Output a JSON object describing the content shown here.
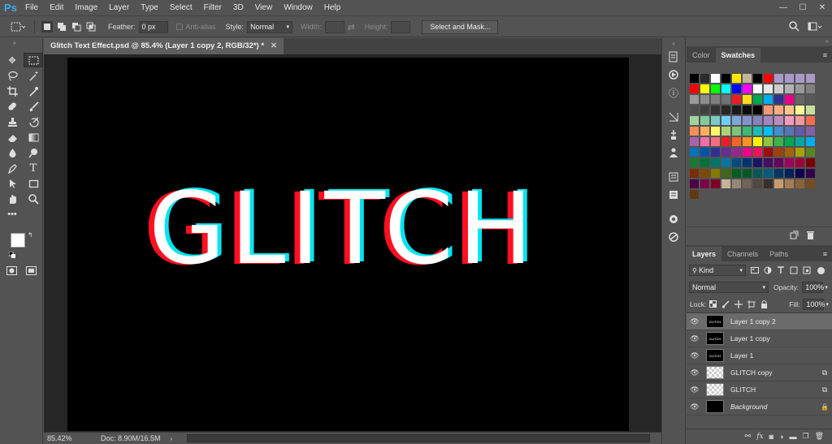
{
  "app": {
    "logo": "Ps"
  },
  "menu": [
    "File",
    "Edit",
    "Image",
    "Layer",
    "Type",
    "Select",
    "Filter",
    "3D",
    "View",
    "Window",
    "Help"
  ],
  "window_controls": [
    "—",
    "☐",
    "✕"
  ],
  "options": {
    "feather_label": "Feather:",
    "feather_value": "0 px",
    "antialias_label": "Anti-alias",
    "style_label": "Style:",
    "style_value": "Normal",
    "width_label": "Width:",
    "height_label": "Height:",
    "select_mask_label": "Select and Mask..."
  },
  "document": {
    "tab_title": "Glitch Text Effect.psd @ 85.4% (Layer 1 copy 2, RGB/32*) *",
    "text": "GLITCH"
  },
  "status": {
    "zoom": "85.42%",
    "doc": "Doc: 8.90M/16.5M"
  },
  "color_panel": {
    "tabs": [
      "Color",
      "Swatches"
    ]
  },
  "swatches": [
    "#000000",
    "#2b2b2b",
    "#ffffff",
    "#000000",
    "#ffe600",
    "#c4b49a",
    "#000000",
    "#ff0000",
    "#a89ac8",
    "#a89ac8",
    "#a89ac8",
    "#a89ac8",
    "#ff0000",
    "#ffff00",
    "#00ff00",
    "#00ffff",
    "#0000ff",
    "#ff00ff",
    "#ffffff",
    "#e6e6e6",
    "#cccccc",
    "#b3b3b3",
    "#999999",
    "#808080",
    "#9a9a9a",
    "#8c8c8c",
    "#7f7f7f",
    "#727272",
    "#ed1c24",
    "#ffde17",
    "#00a651",
    "#00aeef",
    "#2e3192",
    "#ec008c",
    "#666666",
    "#595959",
    "#4d4d4d",
    "#404040",
    "#333333",
    "#262626",
    "#1a1a1a",
    "#0d0d0d",
    "#000000",
    "#f69679",
    "#f9ad81",
    "#fdc689",
    "#fff799",
    "#c4df9b",
    "#a3d39c",
    "#82ca9c",
    "#7accc8",
    "#6dcff6",
    "#7da7d9",
    "#8393ca",
    "#8781bd",
    "#a186be",
    "#bd8cbf",
    "#f49ac1",
    "#f5989d",
    "#f26c4f",
    "#f68e56",
    "#fbaf5d",
    "#fff568",
    "#acd373",
    "#7cc576",
    "#3cb878",
    "#1cbbb4",
    "#00bff3",
    "#448ccb",
    "#5574b9",
    "#605ca8",
    "#855fa8",
    "#a763a8",
    "#f06eaa",
    "#f26d7d",
    "#ed1c24",
    "#f26522",
    "#f7941d",
    "#fff200",
    "#8dc63f",
    "#39b54a",
    "#00a651",
    "#00a99d",
    "#00aeef",
    "#0072bc",
    "#0054a6",
    "#2e3192",
    "#662d91",
    "#92278f",
    "#ec008c",
    "#ed145b",
    "#9e0b0f",
    "#a0410d",
    "#a36209",
    "#aba000",
    "#598527",
    "#1a7b30",
    "#007236",
    "#00746b",
    "#0076a3",
    "#004b80",
    "#003471",
    "#1b1464",
    "#440e62",
    "#630460",
    "#9e005d",
    "#9e0039",
    "#790000",
    "#7b2e00",
    "#7d4900",
    "#827b00",
    "#406618",
    "#005e20",
    "#005826",
    "#005952",
    "#005b7f",
    "#003663",
    "#002157",
    "#0d004c",
    "#32004b",
    "#4b0049",
    "#7b0046",
    "#7a0026",
    "#c7b299",
    "#998675",
    "#736357",
    "#534741",
    "#37302a",
    "#c69c6d",
    "#a67c52",
    "#8c6239",
    "#754c24",
    "#603913"
  ],
  "layers_panel": {
    "tabs": [
      "Layers",
      "Channels",
      "Paths"
    ],
    "kind": "Kind",
    "blend": "Normal",
    "opacity_label": "Opacity:",
    "opacity": "100%",
    "lock_label": "Lock:",
    "fill_label": "Fill:",
    "fill": "100%",
    "layers": [
      {
        "name": "Layer 1 copy 2",
        "thumb": "GLITCH",
        "selected": true
      },
      {
        "name": "Layer 1 copy",
        "thumb": "GLITCH",
        "selected": false
      },
      {
        "name": "Layer 1",
        "thumb": "GLITCH",
        "selected": false
      },
      {
        "name": "GLITCH copy",
        "thumb": "",
        "selected": false
      },
      {
        "name": "GLITCH",
        "thumb": "",
        "selected": false
      },
      {
        "name": "Background",
        "thumb": "",
        "selected": false
      }
    ]
  }
}
